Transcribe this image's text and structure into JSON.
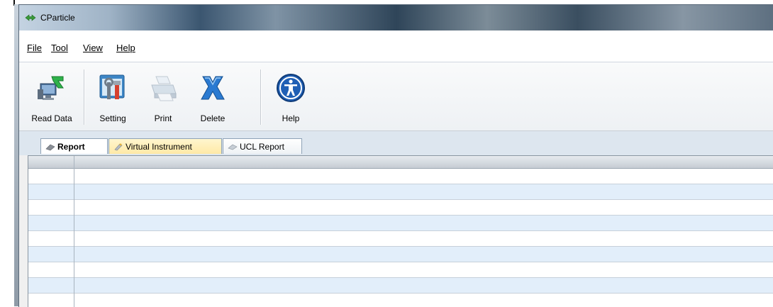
{
  "window": {
    "title": "CParticle"
  },
  "menu": {
    "items": [
      "File",
      "Tool",
      "View",
      "Help"
    ]
  },
  "toolbar": {
    "read_data": "Read Data",
    "setting": "Setting",
    "print": "Print",
    "delete": "Delete",
    "help": "Help"
  },
  "tabs": [
    {
      "label": "Report",
      "icon": "report-icon",
      "active": true
    },
    {
      "label": "Virtual Instrument",
      "icon": "instrument-icon",
      "active": false
    },
    {
      "label": "UCL Report",
      "icon": "ucl-report-icon",
      "active": false
    }
  ],
  "grid": {
    "row_count": 9
  },
  "colors": {
    "alt_row": "#e2eefa",
    "help_icon": "#1f5fb5",
    "delete_icon": "#2a7ad1"
  }
}
